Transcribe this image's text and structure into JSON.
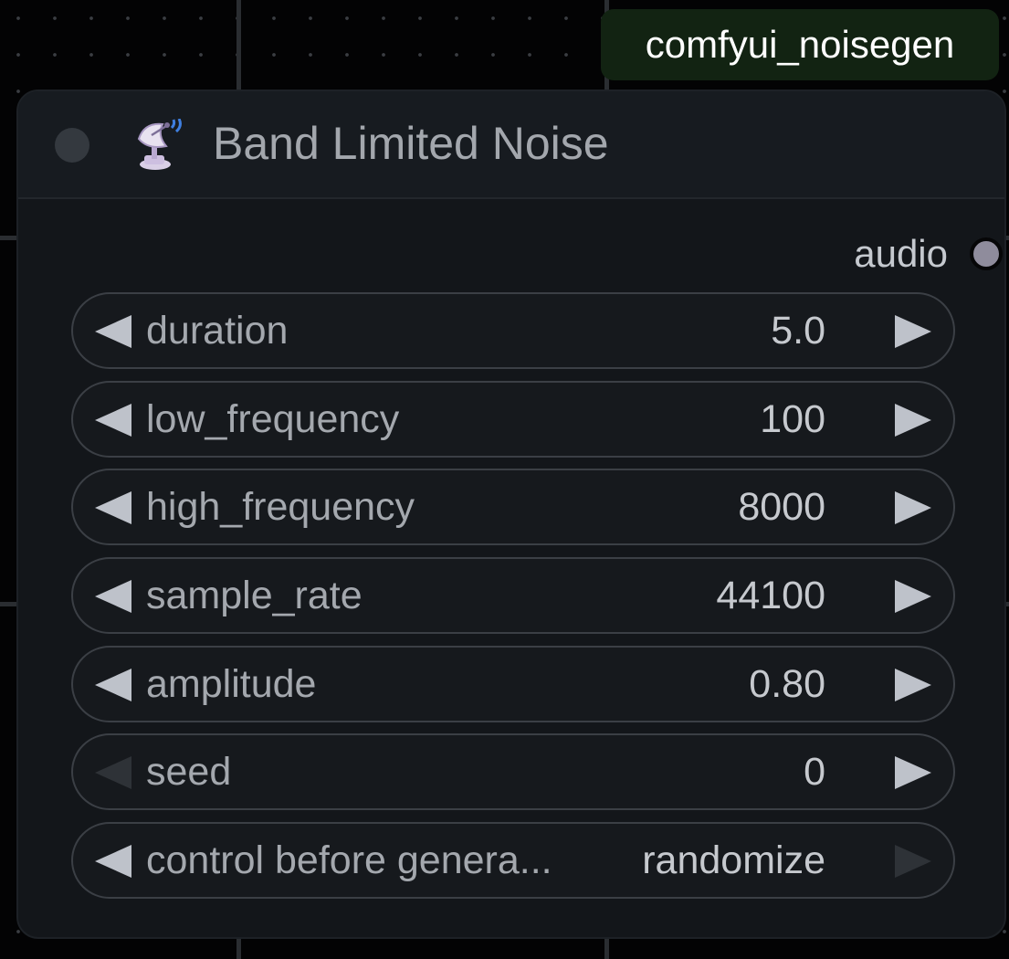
{
  "badge": {
    "text": "comfyui_noisegen",
    "color": "#122312"
  },
  "node": {
    "title": "Band Limited Noise",
    "icon": "satellite-antenna-icon",
    "output": {
      "label": "audio",
      "socket_color": "#8f8c9c"
    },
    "widgets": [
      {
        "name": "duration",
        "label": "duration",
        "value": "5.0",
        "left_enabled": true,
        "right_enabled": true
      },
      {
        "name": "low-frequency",
        "label": "low_frequency",
        "value": "100",
        "left_enabled": true,
        "right_enabled": true
      },
      {
        "name": "high-frequency",
        "label": "high_frequency",
        "value": "8000",
        "left_enabled": true,
        "right_enabled": true
      },
      {
        "name": "sample-rate",
        "label": "sample_rate",
        "value": "44100",
        "left_enabled": true,
        "right_enabled": true
      },
      {
        "name": "amplitude",
        "label": "amplitude",
        "value": "0.80",
        "left_enabled": true,
        "right_enabled": true
      },
      {
        "name": "seed",
        "label": "seed",
        "value": "0",
        "left_enabled": false,
        "right_enabled": true
      },
      {
        "name": "control-before-generate",
        "label": "control before genera...",
        "value": "randomize",
        "left_enabled": true,
        "right_enabled": false
      }
    ]
  }
}
